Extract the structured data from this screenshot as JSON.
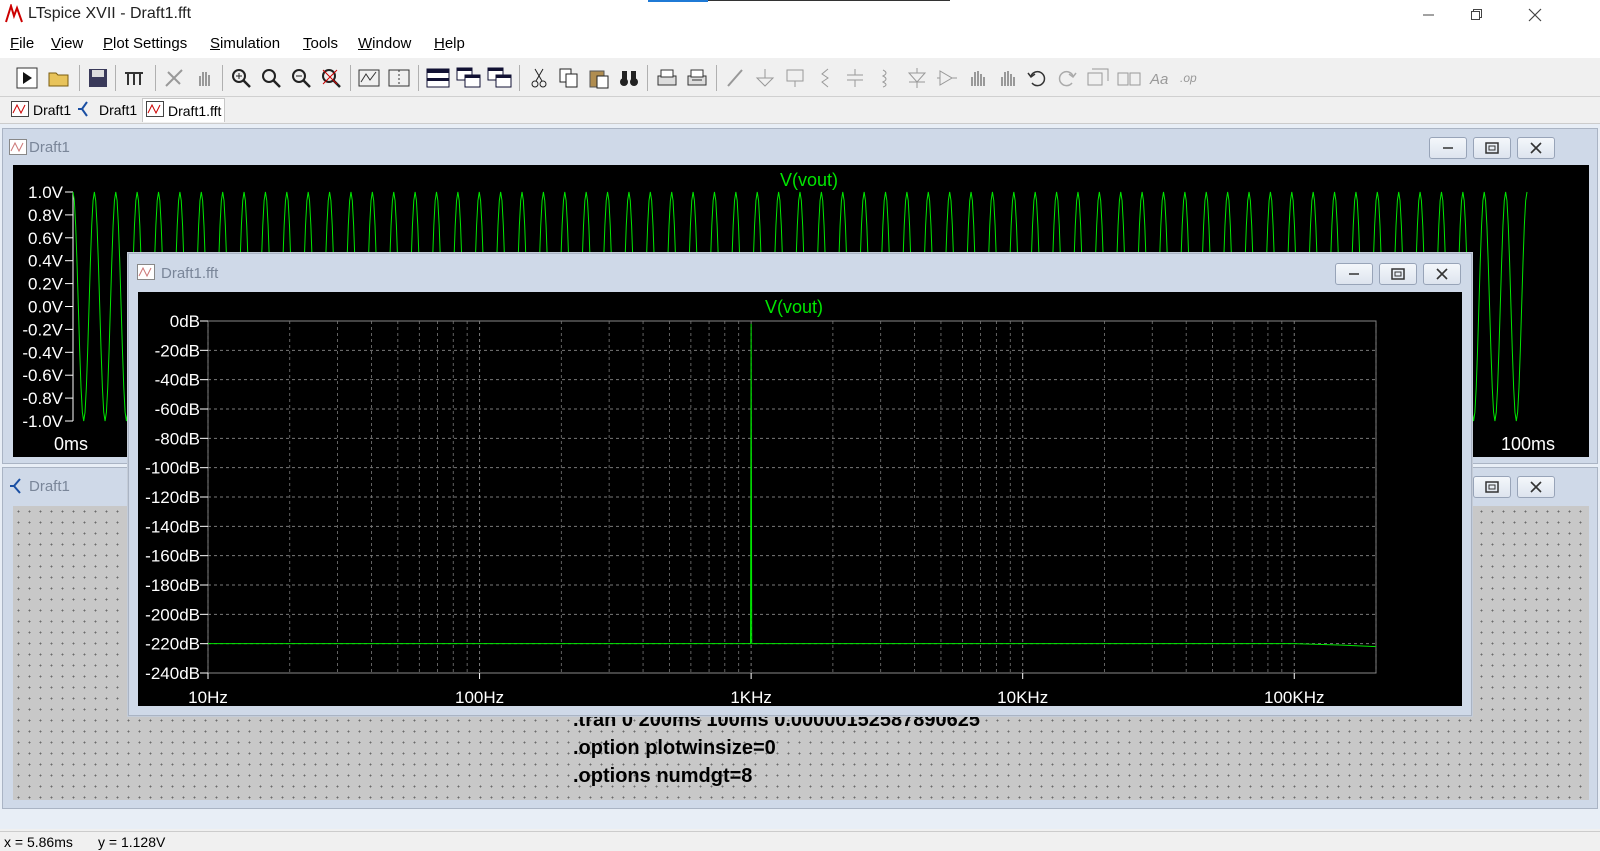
{
  "window": {
    "title": "LTspice XVII - Draft1.fft"
  },
  "menu": {
    "items": [
      {
        "accel": "F",
        "rest": "ile"
      },
      {
        "accel": "V",
        "rest": "iew"
      },
      {
        "accel": "P",
        "rest": "lot Settings"
      },
      {
        "accel": "S",
        "rest": "imulation"
      },
      {
        "accel": "T",
        "rest": "ools"
      },
      {
        "accel": "W",
        "rest": "indow"
      },
      {
        "accel": "H",
        "rest": "elp"
      }
    ]
  },
  "tabs": [
    {
      "label": "Draft1",
      "icon": "waveform-icon"
    },
    {
      "label": "Draft1",
      "icon": "schematic-icon"
    },
    {
      "label": "Draft1.fft",
      "icon": "waveform-icon",
      "active": true
    }
  ],
  "windows": {
    "transient": {
      "title": "Draft1",
      "trace": "V(vout)",
      "trace_color": "#00e600",
      "y_ticks": [
        "1.0V",
        "0.8V",
        "0.6V",
        "0.4V",
        "0.2V",
        "0.0V",
        "-0.2V",
        "-0.4V",
        "-0.6V",
        "-0.8V",
        "-1.0V"
      ],
      "x_start": "0ms",
      "x_end": "100ms"
    },
    "fft": {
      "title": "Draft1.fft",
      "trace": "V(vout)",
      "y_ticks": [
        "0dB",
        "-20dB",
        "-40dB",
        "-60dB",
        "-80dB",
        "-100dB",
        "-120dB",
        "-140dB",
        "-160dB",
        "-180dB",
        "-200dB",
        "-220dB",
        "-240dB"
      ],
      "x_ticks": [
        "10Hz",
        "100Hz",
        "1KHz",
        "10KHz",
        "100KHz"
      ]
    },
    "schematic": {
      "title": "Draft1",
      "directives": [
        ".tran 0 200ms 100ms 0.00000152587890625",
        ".option plotwinsize=0",
        ".options numdgt=8"
      ]
    }
  },
  "chart_data": [
    {
      "type": "line",
      "title": "V(vout)",
      "xlabel": "",
      "ylabel": "",
      "x_unit": "ms",
      "xlim": [
        0,
        100
      ],
      "ylim": [
        -1.0,
        1.0
      ],
      "series": [
        {
          "name": "V(vout)",
          "frequency_hz": 1000,
          "amplitude_v": 1.0,
          "shape": "sine"
        }
      ],
      "grid": false
    },
    {
      "type": "line",
      "title": "V(vout)",
      "xlabel": "",
      "ylabel": "",
      "x_scale": "log",
      "xlim": [
        10,
        200000
      ],
      "ylim": [
        -240,
        0
      ],
      "series": [
        {
          "name": "V(vout)",
          "points": [
            [
              10,
              -220
            ],
            [
              995,
              -220
            ],
            [
              1000,
              -2
            ],
            [
              1005,
              -220
            ],
            [
              100000,
              -220
            ],
            [
              150000,
              -221
            ],
            [
              200000,
              -222
            ]
          ]
        }
      ],
      "grid": true
    }
  ],
  "status": {
    "x": "x = 5.86ms",
    "y": "y = 1.128V"
  }
}
